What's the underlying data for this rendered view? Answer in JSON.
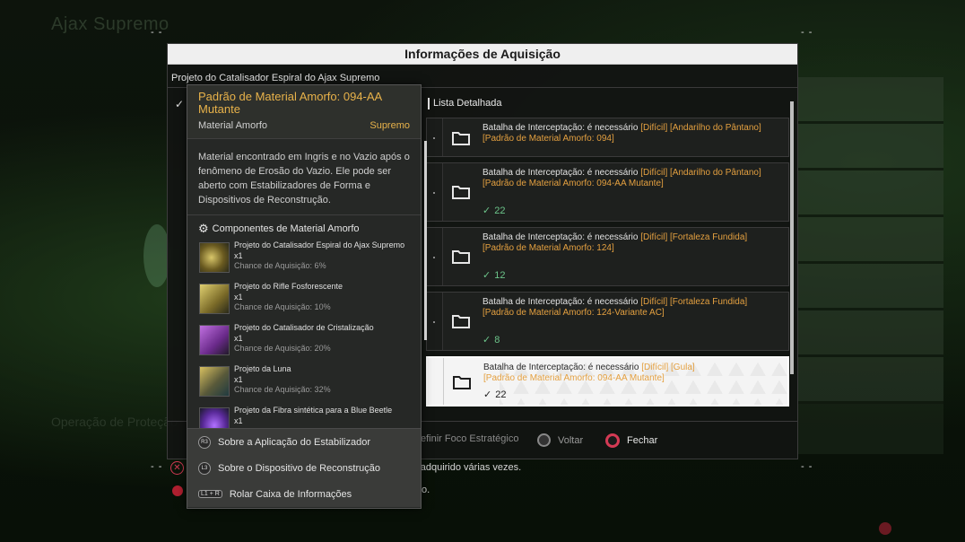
{
  "background": {
    "title": "Ajax Supremo",
    "sub_label": "Operação de Proteção"
  },
  "modal": {
    "title": "Informações de Aquisição",
    "subtitle": "Projeto do Catalisador Espiral do Ajax Supremo",
    "list_title": "Lista Detalhada",
    "entries": [
      {
        "text_prefix": "Batalha de Interceptação: é necessário ",
        "tags": "[Difícil] [Andarilho do Pântano]",
        "material": "[Padrão de Material Amorfo: 094]",
        "count": ""
      },
      {
        "text_prefix": "Batalha de Interceptação: é necessário ",
        "tags": "[Difícil] [Andarilho do Pântano]",
        "material": "[Padrão de Material Amorfo: 094-AA Mutante]",
        "count": "22"
      },
      {
        "text_prefix": "Batalha de Interceptação: é necessário ",
        "tags": "[Difícil] [Fortaleza Fundida]",
        "material": "[Padrão de Material Amorfo: 124]",
        "count": "12"
      },
      {
        "text_prefix": "Batalha de Interceptação: é necessário ",
        "tags": "[Difícil] [Fortaleza Fundida]",
        "material": "[Padrão de Material Amorfo: 124-Variante AC]",
        "count": "8"
      },
      {
        "text_prefix": "Batalha de Interceptação: é necessário ",
        "tags": "[Difícil] [Gula]",
        "material": "[Padrão de Material Amorfo: 094-AA Mutante]",
        "count": "22"
      }
    ],
    "footer": {
      "strategic_focus": "efinir Foco Estratégico",
      "back": "Voltar",
      "close": "Fechar"
    },
    "below_line_1": "r adquirido várias vezes.",
    "below_line_2": "o."
  },
  "tooltip": {
    "name": "Padrão de Material Amorfo: 094-AA Mutante",
    "type": "Material Amorfo",
    "rarity": "Supremo",
    "description": "Material encontrado em Ingris e no Vazio após o fenômeno de Erosão do Vazio. Ele pode ser aberto com Estabilizadores de Forma e Dispositivos de Reconstrução.",
    "components_title": "Componentes de Material Amorfo",
    "components": [
      {
        "name": "Projeto do Catalisador Espiral do Ajax Supremo",
        "qty": "x1",
        "chance": "Chance de Aquisição: 6%",
        "color": "#8a7a3a"
      },
      {
        "name": "Projeto do Rifle Fosforescente",
        "qty": "x1",
        "chance": "Chance de Aquisição: 10%",
        "color": "#9a8a40"
      },
      {
        "name": "Projeto do Catalisador de Cristalização",
        "qty": "x1",
        "chance": "Chance de Aquisição: 20%",
        "color": "#7a3a9a"
      },
      {
        "name": "Projeto da Luna",
        "qty": "x1",
        "chance": "Chance de Aquisição: 32%",
        "color": "#8a7a30"
      },
      {
        "name": "Projeto da Fibra sintética para a Blue Beetle",
        "qty": "x1",
        "chance": "",
        "color": "#6a3aa0"
      }
    ],
    "actions": [
      {
        "glyph": "R3",
        "label": "Sobre a Aplicação do Estabilizador"
      },
      {
        "glyph": "L3",
        "label": "Sobre o Dispositivo de Reconstrução"
      },
      {
        "glyph": "L1 + R",
        "label": "Rolar Caixa de Informações"
      }
    ]
  }
}
